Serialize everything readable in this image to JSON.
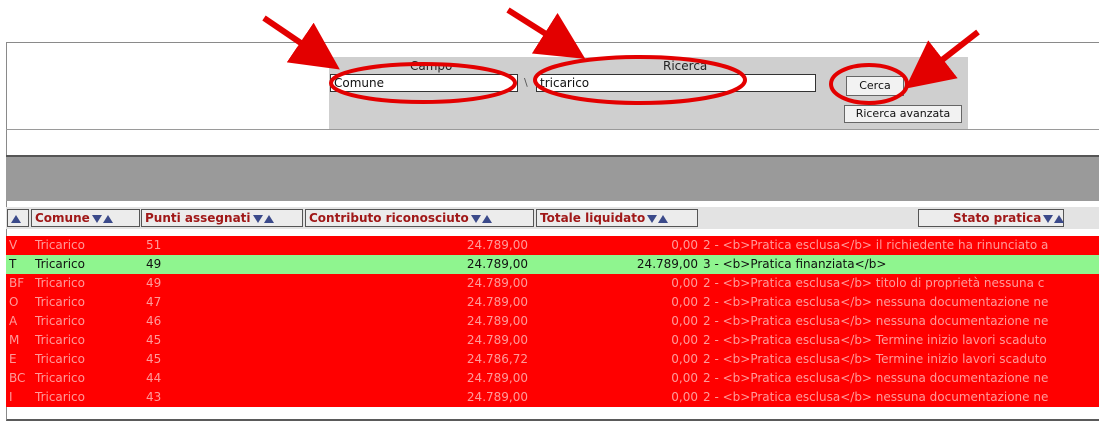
{
  "search": {
    "campo_label": "Campo",
    "campo_value": "Comune",
    "ricerca_label": "Ricerca",
    "ricerca_value": "tricarico",
    "search_button": "Cerca",
    "advanced_button": "Ricerca avanzata"
  },
  "table": {
    "headers": {
      "comune": "Comune",
      "punti": "Punti assegnati",
      "contributo": "Contributo riconosciuto",
      "totale": "Totale liquidato",
      "stato": "Stato pratica"
    },
    "rows": [
      {
        "id": "V",
        "comune": "Tricarico",
        "punti": "51",
        "contributo": "24.789,00",
        "totale": "0,00",
        "stato": "2 - <b>Pratica esclusa</b> il richiedente ha rinunciato a",
        "status": "excluded"
      },
      {
        "id": "T",
        "comune": "Tricarico",
        "punti": "49",
        "contributo": "24.789,00",
        "totale": "24.789,00",
        "stato": "3 - <b>Pratica finanziata</b>",
        "status": "funded"
      },
      {
        "id": "BF",
        "comune": "Tricarico",
        "punti": "49",
        "contributo": "24.789,00",
        "totale": "0,00",
        "stato": "2 - <b>Pratica esclusa</b> titolo di proprietà nessuna c",
        "status": "excluded"
      },
      {
        "id": "O",
        "comune": "Tricarico",
        "punti": "47",
        "contributo": "24.789,00",
        "totale": "0,00",
        "stato": "2 - <b>Pratica esclusa</b> nessuna documentazione ne",
        "status": "excluded"
      },
      {
        "id": "A",
        "comune": "Tricarico",
        "punti": "46",
        "contributo": "24.789,00",
        "totale": "0,00",
        "stato": "2 - <b>Pratica esclusa</b> nessuna documentazione ne",
        "status": "excluded"
      },
      {
        "id": "M",
        "comune": "Tricarico",
        "punti": "45",
        "contributo": "24.789,00",
        "totale": "0,00",
        "stato": "2 - <b>Pratica esclusa</b> Termine inizio lavori scaduto",
        "status": "excluded"
      },
      {
        "id": "E",
        "comune": "Tricarico",
        "punti": "45",
        "contributo": "24.786,72",
        "totale": "0,00",
        "stato": "2 - <b>Pratica esclusa</b> Termine inizio lavori scaduto",
        "status": "excluded"
      },
      {
        "id": "BC",
        "comune": "Tricarico",
        "punti": "44",
        "contributo": "24.789,00",
        "totale": "0,00",
        "stato": "2 - <b>Pratica esclusa</b> nessuna documentazione ne",
        "status": "excluded"
      },
      {
        "id": "I",
        "comune": "Tricarico",
        "punti": "43",
        "contributo": "24.789,00",
        "totale": "0,00",
        "stato": "2 - <b>Pratica esclusa</b> nessuna documentazione ne",
        "status": "excluded"
      }
    ]
  },
  "colors": {
    "excluded_row": "#ff0000",
    "funded_row": "#8ff58f",
    "annotation": "#e30000"
  }
}
